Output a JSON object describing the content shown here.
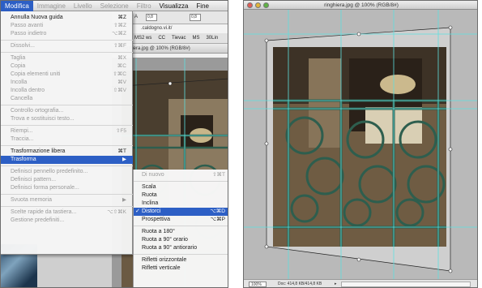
{
  "left_window": {
    "menubar": {
      "items": [
        {
          "label": "Modifica",
          "state": "active"
        },
        {
          "label": "Immagine",
          "state": "dim"
        },
        {
          "label": "Livello",
          "state": "dim"
        },
        {
          "label": "Selezione",
          "state": "dim"
        },
        {
          "label": "Filtro",
          "state": "dim"
        },
        {
          "label": "Visualizza",
          "state": "normal"
        },
        {
          "label": "Fine",
          "state": "normal"
        }
      ]
    },
    "toolbar_fields": [
      "0,8",
      "0,8"
    ],
    "toolbar_text": "A",
    "url_text": ".caldogno.vi.it/",
    "options_bar": [
      "MS2 ws",
      "CC",
      "Tievac",
      "MS",
      "30Lin"
    ],
    "doc_title": "inghiera.jpg @ 100% (RGB/8#)",
    "edit_menu": [
      {
        "label": "Annulla Nuova guida",
        "shortcut": "⌘Z",
        "disabled": false
      },
      {
        "label": "Passo avanti",
        "shortcut": "⇧⌘Z",
        "disabled": true
      },
      {
        "label": "Passo indietro",
        "shortcut": "⌥⌘Z",
        "disabled": true
      },
      {
        "sep": true
      },
      {
        "label": "Dissolvi...",
        "shortcut": "⇧⌘F",
        "disabled": true
      },
      {
        "sep": true
      },
      {
        "label": "Taglia",
        "shortcut": "⌘X",
        "disabled": true
      },
      {
        "label": "Copia",
        "shortcut": "⌘C",
        "disabled": true
      },
      {
        "label": "Copia elementi uniti",
        "shortcut": "⇧⌘C",
        "disabled": true
      },
      {
        "label": "Incolla",
        "shortcut": "⌘V",
        "disabled": true
      },
      {
        "label": "Incolla dentro",
        "shortcut": "⇧⌘V",
        "disabled": true
      },
      {
        "label": "Cancella",
        "shortcut": "",
        "disabled": true
      },
      {
        "sep": true
      },
      {
        "label": "Controllo ortografia...",
        "shortcut": "",
        "disabled": true
      },
      {
        "label": "Trova e sostituisci testo...",
        "shortcut": "",
        "disabled": true
      },
      {
        "sep": true
      },
      {
        "label": "Riempi...",
        "shortcut": "⇧F5",
        "disabled": true
      },
      {
        "label": "Traccia...",
        "shortcut": "",
        "disabled": true
      },
      {
        "sep": true
      },
      {
        "label": "Trasformazione libera",
        "shortcut": "⌘T",
        "disabled": false
      },
      {
        "label": "Trasforma",
        "shortcut": "▶",
        "disabled": false,
        "highlighted": true
      },
      {
        "sep": true
      },
      {
        "label": "Definisci pennello predefinito...",
        "shortcut": "",
        "disabled": true
      },
      {
        "label": "Definisci pattern...",
        "shortcut": "",
        "disabled": true
      },
      {
        "label": "Definisci forma personale...",
        "shortcut": "",
        "disabled": true
      },
      {
        "sep": true
      },
      {
        "label": "Svuota memoria",
        "shortcut": "▶",
        "disabled": true
      },
      {
        "sep": true
      },
      {
        "label": "Scelte rapide da tastiera...",
        "shortcut": "⌥⇧⌘K",
        "disabled": true
      },
      {
        "label": "Gestione predefiniti...",
        "shortcut": "",
        "disabled": true
      }
    ],
    "transform_submenu": [
      {
        "label": "Di nuovo",
        "shortcut": "⇧⌘T",
        "disabled": true
      },
      {
        "sep": true
      },
      {
        "label": "Scala",
        "shortcut": "",
        "disabled": false
      },
      {
        "label": "Ruota",
        "shortcut": "",
        "disabled": false
      },
      {
        "label": "Inclina",
        "shortcut": "",
        "disabled": false
      },
      {
        "label": "Distorci",
        "shortcut": "⌥⌘D",
        "disabled": false,
        "highlighted": true,
        "checked": true
      },
      {
        "label": "Prospettiva",
        "shortcut": "⌥⌘P",
        "disabled": false
      },
      {
        "sep": true
      },
      {
        "label": "Ruota a 180°",
        "shortcut": "",
        "disabled": false
      },
      {
        "label": "Ruota a 90° orario",
        "shortcut": "",
        "disabled": false
      },
      {
        "label": "Ruota a 90° antiorario",
        "shortcut": "",
        "disabled": false
      },
      {
        "sep": true
      },
      {
        "label": "Rifletti orizzontale",
        "shortcut": "",
        "disabled": false
      },
      {
        "label": "Rifletti verticale",
        "shortcut": "",
        "disabled": false
      }
    ]
  },
  "right_window": {
    "title": "ringhiera.jpg @ 100% (RGB/8#)",
    "status_zoom": "100%",
    "status_doc": "Doc: 414,8 KB/414,8 KB"
  },
  "colors": {
    "menu_highlight": "#2d5fc5",
    "guide": "#5ee0e0",
    "railing": "#2e5e4e"
  }
}
